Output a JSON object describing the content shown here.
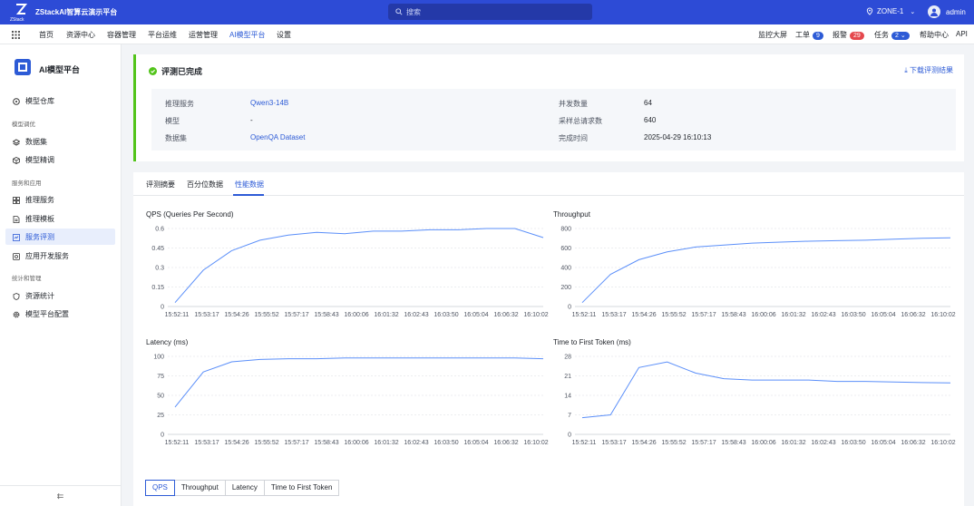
{
  "header": {
    "brand_line1": "ZStack",
    "brand": "ZStackAI智算云演示平台",
    "search_placeholder": "搜索",
    "zone": "ZONE-1",
    "user": "admin"
  },
  "nav": {
    "items": [
      "首页",
      "资源中心",
      "容器管理",
      "平台运维",
      "运营管理",
      "AI模型平台",
      "设置"
    ],
    "active": "AI模型平台",
    "right": {
      "monitor": "监控大屏",
      "tickets": "工单",
      "tickets_count": "9",
      "alarms": "报警",
      "alarms_count": "29",
      "tasks": "任务",
      "tasks_count": "2",
      "help": "帮助中心",
      "api": "API"
    }
  },
  "sidebar": {
    "title": "AI模型平台",
    "model_repo": "模型仓库",
    "group_tuning": "模型调优",
    "dataset": "数据集",
    "finetune": "模型精调",
    "group_service": "服务和应用",
    "inference": "推理服务",
    "template": "推理模板",
    "evaluation": "服务评测",
    "app_dev": "应用开发服务",
    "group_stats": "统计和管理",
    "resource_stats": "资源统计",
    "platform_config": "模型平台配置",
    "collapse": "⇇"
  },
  "status": {
    "title": "评测已完成",
    "download": "下载评测结果",
    "fields": {
      "service_label": "推理服务",
      "service_value": "Qwen3-14B",
      "model_label": "模型",
      "model_value": "-",
      "dataset_label": "数据集",
      "dataset_value": "OpenQA Dataset",
      "concurrency_label": "并发数量",
      "concurrency_value": "64",
      "requests_label": "采样总请求数",
      "requests_value": "640",
      "finish_label": "完成时间",
      "finish_value": "2025-04-29 16:10:13"
    }
  },
  "tabs": [
    "评测摘要",
    "百分位数据",
    "性能数据"
  ],
  "active_tab": "性能数据",
  "segments": [
    "QPS",
    "Throughput",
    "Latency",
    "Time to First Token"
  ],
  "active_segment": "QPS",
  "colors": {
    "accent": "#2d5bd6",
    "line": "#5b8ff9",
    "success": "#52c41a",
    "alarm": "#e5484d"
  },
  "chart_data": [
    {
      "type": "line",
      "title": "QPS (Queries Per Second)",
      "x": [
        "15:52:11",
        "15:53:17",
        "15:54:26",
        "15:55:52",
        "15:57:17",
        "15:58:43",
        "16:00:06",
        "16:01:32",
        "16:02:43",
        "16:03:50",
        "16:05:04",
        "16:06:32",
        "16:10:02"
      ],
      "ylim": [
        0,
        0.6
      ],
      "yticks": [
        "0",
        "0.15",
        "0.3",
        "0.45",
        "0.6"
      ],
      "grid": true,
      "series": [
        {
          "values": [
            0.03,
            0.28,
            0.43,
            0.51,
            0.55,
            0.57,
            0.56,
            0.58,
            0.58,
            0.59,
            0.59,
            0.6,
            0.6,
            0.53
          ]
        }
      ]
    },
    {
      "type": "line",
      "title": "Throughput",
      "x": [
        "15:52:11",
        "15:53:17",
        "15:54:26",
        "15:55:52",
        "15:57:17",
        "15:58:43",
        "16:00:06",
        "16:01:32",
        "16:02:43",
        "16:03:50",
        "16:05:04",
        "16:06:32",
        "16:10:02"
      ],
      "ylim": [
        0,
        800
      ],
      "yticks": [
        "0",
        "200",
        "400",
        "600",
        "800"
      ],
      "grid": true,
      "series": [
        {
          "values": [
            40,
            330,
            480,
            560,
            610,
            630,
            650,
            660,
            670,
            675,
            680,
            690,
            700,
            705
          ]
        }
      ]
    },
    {
      "type": "line",
      "title": "Latency (ms)",
      "x": [
        "15:52:11",
        "15:53:17",
        "15:54:26",
        "15:55:52",
        "15:57:17",
        "15:58:43",
        "16:00:06",
        "16:01:32",
        "16:02:43",
        "16:03:50",
        "16:05:04",
        "16:06:32",
        "16:10:02"
      ],
      "ylim": [
        0,
        100
      ],
      "yticks": [
        "0",
        "25",
        "50",
        "75",
        "100"
      ],
      "grid": true,
      "series": [
        {
          "values": [
            35,
            80,
            93,
            96,
            97,
            97,
            98,
            98,
            98,
            98,
            98,
            98,
            98,
            97
          ]
        }
      ]
    },
    {
      "type": "line",
      "title": "Time to First Token (ms)",
      "x": [
        "15:52:11",
        "15:53:17",
        "15:54:26",
        "15:55:52",
        "15:57:17",
        "15:58:43",
        "16:00:06",
        "16:01:32",
        "16:02:43",
        "16:03:50",
        "16:05:04",
        "16:06:32",
        "16:10:02"
      ],
      "ylim": [
        0,
        28
      ],
      "yticks": [
        "0",
        "7",
        "14",
        "21",
        "28"
      ],
      "grid": true,
      "series": [
        {
          "values": [
            6,
            7,
            24,
            26,
            22,
            20,
            19.5,
            19.5,
            19.5,
            19,
            19,
            18.8,
            18.6,
            18.5
          ]
        }
      ]
    }
  ]
}
